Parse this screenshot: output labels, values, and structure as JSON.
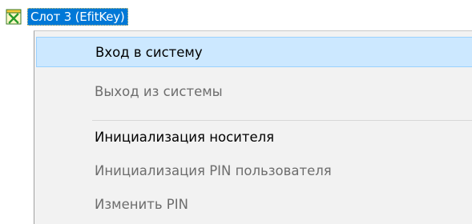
{
  "tree": {
    "slot_label": "Слот 3 (EfitKey)",
    "slot_icon": "token-slot-icon"
  },
  "context_menu": {
    "items": [
      {
        "label": "Вход в систему",
        "enabled": true,
        "highlighted": true
      },
      {
        "label": "Выход из системы",
        "enabled": false,
        "highlighted": false
      },
      {
        "label": "Инициализация носителя",
        "enabled": true,
        "highlighted": false
      },
      {
        "label": "Инициализация PIN пользователя",
        "enabled": false,
        "highlighted": false
      },
      {
        "label": "Изменить PIN",
        "enabled": false,
        "highlighted": false
      }
    ]
  },
  "colors": {
    "selection": "#0078d7",
    "menu_background": "#f2f2f2",
    "hover": "#cce8ff",
    "disabled_text": "#6d6d6d"
  }
}
